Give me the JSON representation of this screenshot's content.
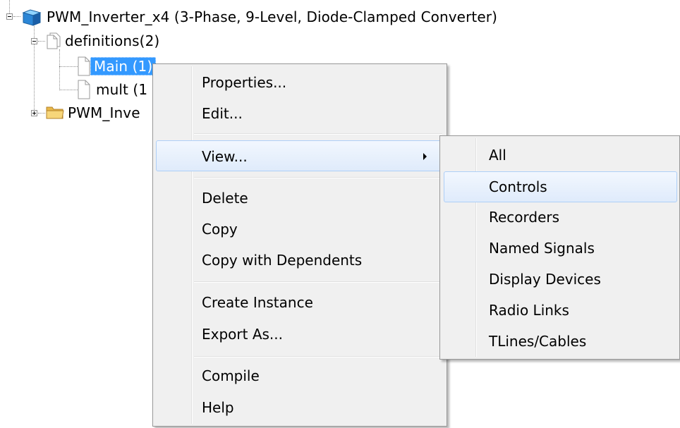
{
  "tree": {
    "root_label": "PWM_Inverter_x4 (3-Phase, 9-Level, Diode-Clamped Converter)",
    "definitions_label": "definitions(2)",
    "main_label": "Main (1)",
    "mult_label": "mult (1",
    "folder_label": "PWM_Inve"
  },
  "context_menu": {
    "items": [
      {
        "label": "Properties..."
      },
      {
        "label": "Edit..."
      },
      {
        "label": "View..."
      },
      {
        "label": "Delete"
      },
      {
        "label": "Copy"
      },
      {
        "label": "Copy with Dependents"
      },
      {
        "label": "Create Instance"
      },
      {
        "label": "Export As..."
      },
      {
        "label": "Compile"
      },
      {
        "label": "Help"
      }
    ],
    "highlighted": "View..."
  },
  "view_submenu": {
    "items": [
      {
        "label": "All"
      },
      {
        "label": "Controls"
      },
      {
        "label": "Recorders"
      },
      {
        "label": "Named Signals"
      },
      {
        "label": "Display Devices"
      },
      {
        "label": "Radio Links"
      },
      {
        "label": "TLines/Cables"
      }
    ],
    "highlighted": "Controls"
  },
  "icons": {
    "root": "project-cube-icon",
    "definitions": "document-stack-icon",
    "main": "document-icon",
    "mult": "document-icon",
    "folder": "folder-icon",
    "submenu": "chevron-right-icon"
  },
  "colors": {
    "selection": "#3399ff",
    "menu_bg": "#f0f0f0",
    "menu_highlight": "#dfebfb",
    "menu_highlight_border": "#aecff7"
  }
}
